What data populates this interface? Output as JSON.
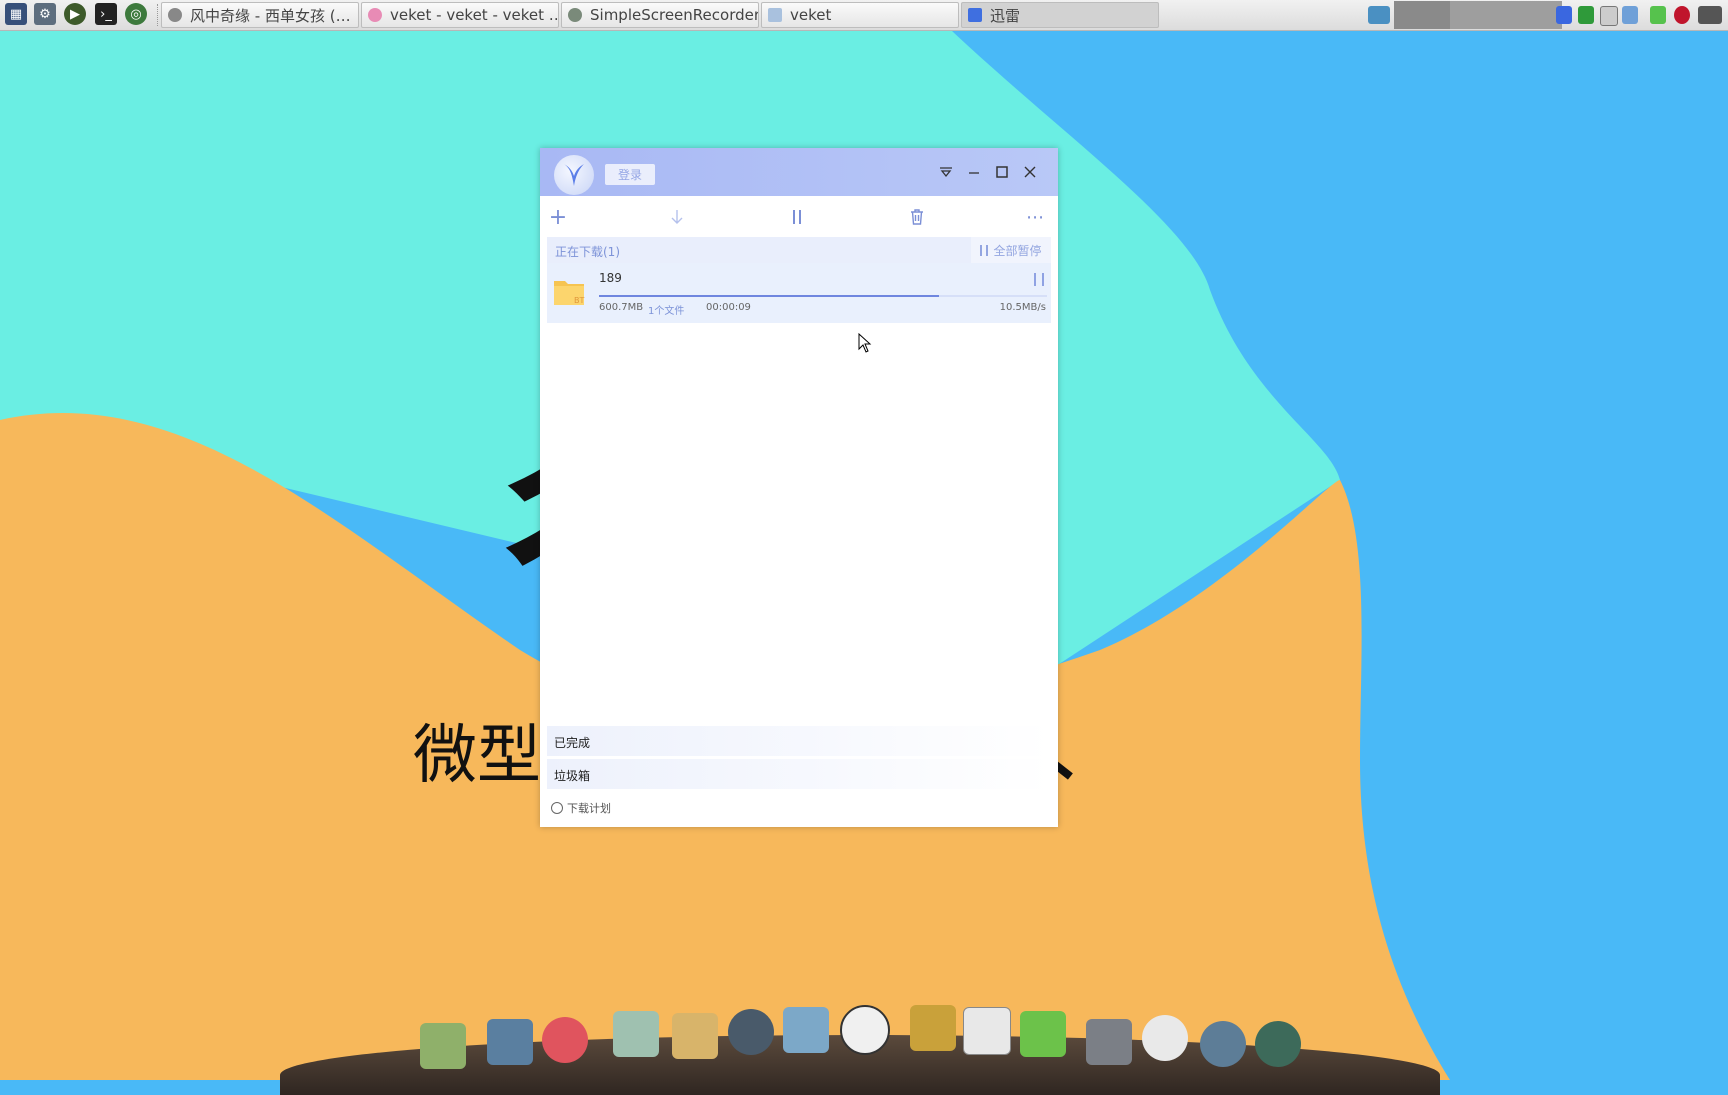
{
  "taskbar": {
    "launchers": [
      {
        "icon": "system-monitor-icon",
        "color": "#37507a"
      },
      {
        "icon": "settings-icon",
        "color": "#4f5f70"
      },
      {
        "icon": "media-play-icon",
        "color": "#3d5a2a"
      },
      {
        "icon": "terminal-icon",
        "color": "#222222"
      },
      {
        "icon": "web-browser-icon",
        "color": "#3d7a3d"
      }
    ],
    "tasks": [
      {
        "label": "风中奇缘 - 西单女孩 (…",
        "icon": "music-player-icon",
        "active": false
      },
      {
        "label": "veket - veket - veket …",
        "icon": "browser-icon",
        "active": false
      },
      {
        "label": "SimpleScreenRecorder",
        "icon": "screen-recorder-icon",
        "active": false
      },
      {
        "label": "veket",
        "icon": "folder-icon",
        "active": false
      },
      {
        "label": "迅雷",
        "icon": "thunder-icon",
        "active": true
      }
    ]
  },
  "wallpaper": {
    "big_glyph": "彳",
    "subtitle": "微型"
  },
  "xunlei": {
    "login_label": "登录",
    "toolbar": {
      "add": "+",
      "more": "⋯"
    },
    "downloading_section": "正在下载(1)",
    "pause_all_label": "全部暂停",
    "task": {
      "name": "189",
      "badge": "BT",
      "size": "600.7MB",
      "files": "1个文件",
      "elapsed": "00:00:09",
      "speed": "10.5MB/s",
      "progress": 0.76
    },
    "completed_section": "已完成",
    "trash_section": "垃圾箱",
    "schedule_label": "下载计划"
  },
  "colors": {
    "accent": "#7b8fd6",
    "wallpaper_cyan": "#6aeee3",
    "wallpaper_blue": "#49b9f7",
    "wallpaper_orange": "#f7b85b"
  }
}
